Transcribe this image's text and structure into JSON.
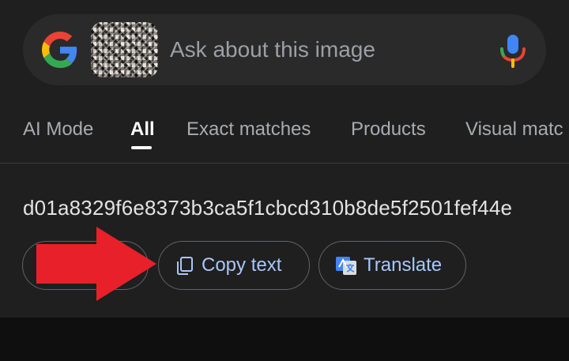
{
  "search": {
    "placeholder": "Ask about this image"
  },
  "tabs": [
    {
      "label": "AI Mode",
      "active": false
    },
    {
      "label": "All",
      "active": true
    },
    {
      "label": "Exact matches",
      "active": false
    },
    {
      "label": "Products",
      "active": false
    },
    {
      "label": "Visual matc",
      "active": false
    }
  ],
  "result": {
    "hash_text": "d01a8329f6e8373b3ca5f1cbcd310b8de5f2501fef44e"
  },
  "actions": {
    "copy_label": "Copy text",
    "translate_label": "Translate"
  },
  "colors": {
    "background": "#1f1f1f",
    "accent_text": "#a8c7fa",
    "arrow": "#e8202a"
  },
  "icons": {
    "logo": "google-g-icon",
    "mic": "mic-icon",
    "copy": "copy-icon",
    "translate": "translate-icon",
    "annotation": "red-arrow-icon"
  }
}
